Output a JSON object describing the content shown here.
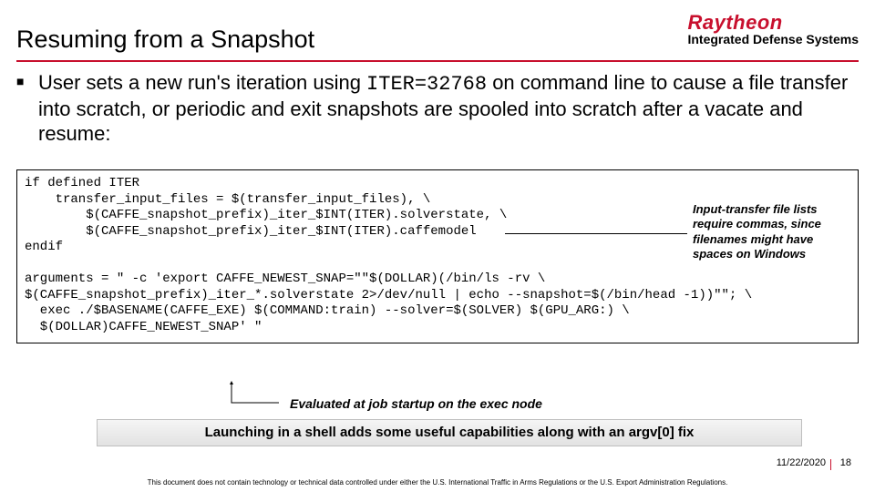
{
  "brand": {
    "name": "Raytheon",
    "sub": "Integrated Defense Systems"
  },
  "title": "Resuming from a Snapshot",
  "bullet": {
    "pre": "User sets a new run's iteration using ",
    "code": "ITER=32768",
    "post": " on command line to cause a file transfer into scratch, or periodic and exit snapshots are spooled into scratch after a vacate and resume:"
  },
  "code": "if defined ITER\n    transfer_input_files = $(transfer_input_files), \\\n        $(CAFFE_snapshot_prefix)_iter_$INT(ITER).solverstate, \\\n        $(CAFFE_snapshot_prefix)_iter_$INT(ITER).caffemodel\nendif\n\narguments = \" -c 'export CAFFE_NEWEST_SNAP=\"\"$(DOLLAR)(/bin/ls -rv \\\n$(CAFFE_snapshot_prefix)_iter_*.solverstate 2>/dev/null | echo --snapshot=$(/bin/head -1))\"\"; \\\n  exec ./$BASENAME(CAFFE_EXE) $(COMMAND:train) --solver=$(SOLVER) $(GPU_ARG:) \\\n  $(DOLLAR)CAFFE_NEWEST_SNAP' \"",
  "note": "Input-transfer file lists require commas, since filenames might have spaces on Windows",
  "eval_note": "Evaluated at job startup on the exec node",
  "banner": "Launching in a shell adds some useful capabilities along with an argv[0] fix",
  "footer": {
    "date": "11/22/2020",
    "page": "18"
  },
  "disclaimer": "This document does not contain technology or technical data controlled under either the U.S. International Traffic in Arms Regulations or the U.S. Export Administration Regulations."
}
